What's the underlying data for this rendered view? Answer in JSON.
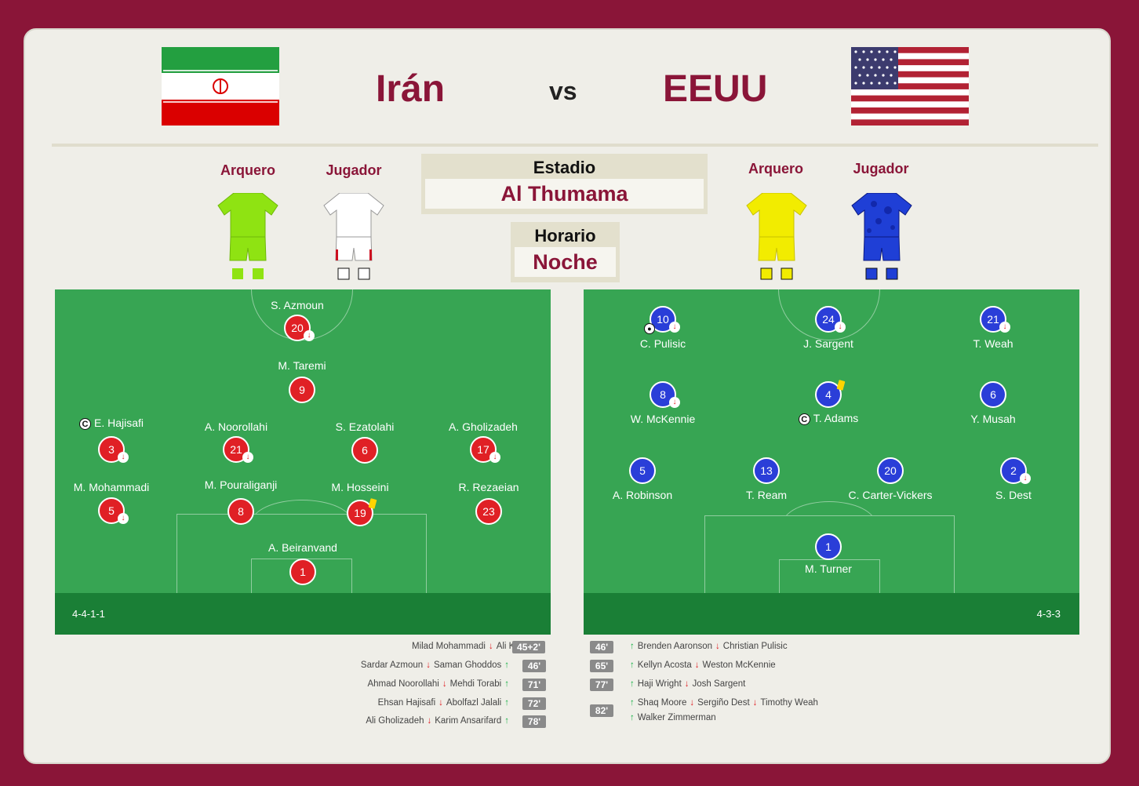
{
  "header": {
    "home_team": "Irán",
    "vs": "vs",
    "away_team": "EEUU"
  },
  "kits": {
    "home": {
      "gk_label": "Arquero",
      "player_label": "Jugador"
    },
    "away": {
      "gk_label": "Arquero",
      "player_label": "Jugador"
    }
  },
  "venue": {
    "stadium_title": "Estadio",
    "stadium_name": "Al Thumama",
    "time_title": "Horario",
    "time_value": "Noche"
  },
  "home_lineup": {
    "formation": "4-4-1-1",
    "players": [
      {
        "name": "S. Azmoun",
        "number": "20"
      },
      {
        "name": "M. Taremi",
        "number": "9"
      },
      {
        "name": "E. Hajisafi",
        "number": "3"
      },
      {
        "name": "A. Noorollahi",
        "number": "21"
      },
      {
        "name": "S. Ezatolahi",
        "number": "6"
      },
      {
        "name": "A. Gholizadeh",
        "number": "17"
      },
      {
        "name": "M. Mohammadi",
        "number": "5"
      },
      {
        "name": "M. Pouraliganji",
        "number": "8"
      },
      {
        "name": "M. Hosseini",
        "number": "19"
      },
      {
        "name": "R. Rezaeian",
        "number": "23"
      },
      {
        "name": "A. Beiranvand",
        "number": "1"
      }
    ]
  },
  "away_lineup": {
    "formation": "4-3-3",
    "players": [
      {
        "name": "C. Pulisic",
        "number": "10"
      },
      {
        "name": "J. Sargent",
        "number": "24"
      },
      {
        "name": "T. Weah",
        "number": "21"
      },
      {
        "name": "W. McKennie",
        "number": "8"
      },
      {
        "name": "T. Adams",
        "number": "4"
      },
      {
        "name": "Y. Musah",
        "number": "6"
      },
      {
        "name": "A. Robinson",
        "number": "5"
      },
      {
        "name": "T. Ream",
        "number": "13"
      },
      {
        "name": "C. Carter-Vickers",
        "number": "20"
      },
      {
        "name": "S. Dest",
        "number": "2"
      },
      {
        "name": "M. Turner",
        "number": "1"
      }
    ]
  },
  "home_subs": [
    {
      "out": "Milad Mohammadi",
      "in": "Ali Karimi",
      "minute": "45+2'"
    },
    {
      "out": "Sardar Azmoun",
      "in": "Saman Ghoddos",
      "minute": "46'"
    },
    {
      "out": "Ahmad Noorollahi",
      "in": "Mehdi Torabi",
      "minute": "71'"
    },
    {
      "out": "Ehsan Hajisafi",
      "in": "Abolfazl Jalali",
      "minute": "72'"
    },
    {
      "out": "Ali Gholizadeh",
      "in": "Karim Ansarifard",
      "minute": "78'"
    }
  ],
  "away_subs": [
    {
      "minute": "46'",
      "in": "Brenden Aaronson",
      "out": "Christian Pulisic"
    },
    {
      "minute": "65'",
      "in": "Kellyn Acosta",
      "out": "Weston McKennie"
    },
    {
      "minute": "77'",
      "in": "Haji Wright",
      "out": "Josh Sargent"
    },
    {
      "minute": "82'",
      "in": "Shaq Moore",
      "out": "Sergiño Dest",
      "out2": "Timothy Weah",
      "in2": "Walker Zimmerman"
    }
  ],
  "icons": {
    "captain": "C",
    "sub_off": "↓",
    "sub_in": "↑",
    "sub_out": "↓"
  },
  "colors": {
    "brand": "#8a1538",
    "pitch": "#37a553",
    "home_badge": "#e02025",
    "away_badge": "#2a3ed8",
    "yellow_card": "#ffd400"
  }
}
